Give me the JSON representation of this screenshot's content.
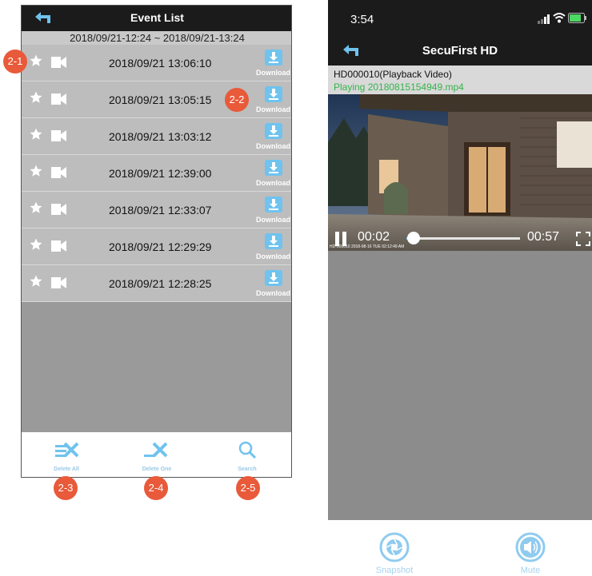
{
  "left": {
    "title": "Event List",
    "range": "2018/09/21-12:24 ~ 2018/09/21-13:24",
    "events": [
      {
        "time": "2018/09/21  13:06:10",
        "download": "Download"
      },
      {
        "time": "2018/09/21  13:05:15",
        "download": "Download"
      },
      {
        "time": "2018/09/21  13:03:12",
        "download": "Download"
      },
      {
        "time": "2018/09/21  12:39:00",
        "download": "Download"
      },
      {
        "time": "2018/09/21  12:33:07",
        "download": "Download"
      },
      {
        "time": "2018/09/21  12:29:29",
        "download": "Download"
      },
      {
        "time": "2018/09/21  12:28:25",
        "download": "Download"
      }
    ],
    "bottom": {
      "delete_all": "Delete All",
      "delete_one": "Delete One",
      "search": "Search"
    }
  },
  "badges": {
    "b1": "2-1",
    "b2": "2-2",
    "b3": "2-3",
    "b4": "2-4",
    "b5": "2-5"
  },
  "right": {
    "clock": "3:54",
    "title": "SecuFirst HD",
    "device": "HD000010(Playback Video)",
    "playing": "Playing 20180815154949.mp4",
    "elapsed": "00:02",
    "duration": "00:57",
    "playback_progress": 0.06,
    "osd": "HD-000010 2018-08-16 TUE 02:12:49 AM",
    "snapshot": "Snapshot",
    "mute": "Mute"
  },
  "colors": {
    "accent": "#6fc3ee",
    "badge": "#e85a3a",
    "playing_text": "#33b44a"
  }
}
